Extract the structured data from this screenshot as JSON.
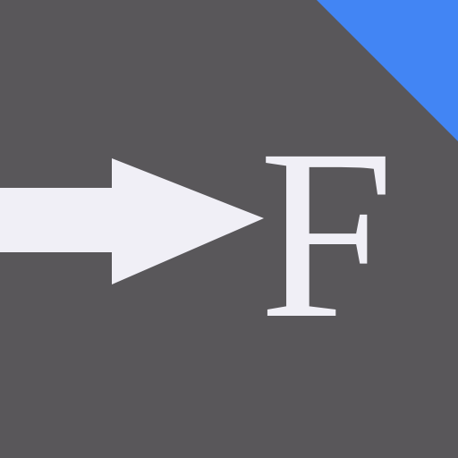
{
  "icon": {
    "name": "forward-to-f-app-icon",
    "glyph": "F",
    "symbol": "right-arrow-icon",
    "colors": {
      "background": "#59575a",
      "corner_accent": "#4285f4",
      "arrow": "#f0eff6",
      "glyph": "#f0eff6"
    }
  }
}
